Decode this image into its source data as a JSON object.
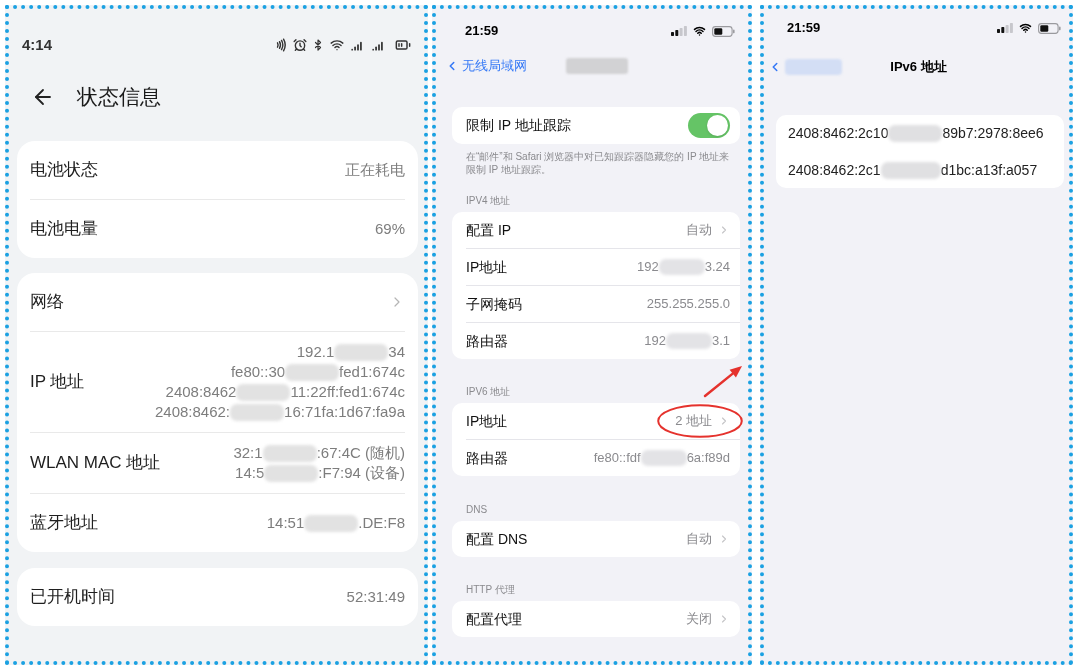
{
  "status_info_screen": {
    "status_bar": {
      "time": "4:14"
    },
    "header": {
      "title": "状态信息"
    },
    "cards": [
      {
        "rows": [
          {
            "label": "电池状态",
            "chevron": false,
            "lines": [
              [
                {
                  "kind": "text",
                  "text": "正在耗电"
                }
              ]
            ]
          },
          {
            "label": "电池电量",
            "chevron": false,
            "lines": [
              [
                {
                  "kind": "text",
                  "text": "69%"
                }
              ]
            ]
          }
        ]
      },
      {
        "rows": [
          {
            "label": "网络",
            "chevron": true,
            "lines": []
          },
          {
            "label": "IP 地址",
            "chevron": false,
            "lines": [
              [
                {
                  "kind": "text",
                  "text": "192.1"
                },
                {
                  "kind": "blurred"
                },
                {
                  "kind": "text",
                  "text": "34"
                }
              ],
              [
                {
                  "kind": "text",
                  "text": "fe80::30"
                },
                {
                  "kind": "blurred"
                },
                {
                  "kind": "text",
                  "text": "fed1:674c"
                }
              ],
              [
                {
                  "kind": "text",
                  "text": "2408:8462"
                },
                {
                  "kind": "blurred"
                },
                {
                  "kind": "text",
                  "text": "11:22ff:fed1:674c"
                }
              ],
              [
                {
                  "kind": "text",
                  "text": "2408:8462:"
                },
                {
                  "kind": "blurred"
                },
                {
                  "kind": "text",
                  "text": "16:71fa:1d67:fa9a"
                }
              ]
            ]
          },
          {
            "label": "WLAN MAC 地址",
            "chevron": false,
            "lines": [
              [
                {
                  "kind": "text",
                  "text": "32:1"
                },
                {
                  "kind": "blurred"
                },
                {
                  "kind": "text",
                  "text": ":67:4C (随机)"
                }
              ],
              [
                {
                  "kind": "text",
                  "text": "14:5"
                },
                {
                  "kind": "blurred"
                },
                {
                  "kind": "text",
                  "text": ":F7:94 (设备)"
                }
              ]
            ]
          },
          {
            "label": "蓝牙地址",
            "chevron": false,
            "lines": [
              [
                {
                  "kind": "text",
                  "text": "14:51"
                },
                {
                  "kind": "blurred"
                },
                {
                  "kind": "text",
                  "text": ".DE:F8"
                }
              ]
            ]
          }
        ]
      },
      {
        "rows": [
          {
            "label": "已开机时间",
            "chevron": false,
            "lines": [
              [
                {
                  "kind": "text",
                  "text": "52:31:49"
                }
              ]
            ]
          }
        ]
      }
    ]
  },
  "wlan_detail_screen": {
    "status_bar": {
      "time": "21:59"
    },
    "nav": {
      "back": [
        {
          "kind": "text",
          "text": "无线局域网"
        }
      ],
      "title": [
        {
          "kind": "blurred"
        }
      ]
    },
    "privacy": {
      "label": "限制 IP 地址跟踪",
      "on": true,
      "footer": "在“邮件”和 Safari 浏览器中对已知跟踪器隐藏您的 IP 地址来限制 IP 地址跟踪。"
    },
    "sections": [
      {
        "header": "IPV4 地址",
        "rows": [
          {
            "label": "配置 IP",
            "chevron": true,
            "circled": false,
            "value": [
              {
                "kind": "text",
                "text": "自动"
              }
            ]
          },
          {
            "label": "IP地址",
            "chevron": false,
            "circled": false,
            "value": [
              {
                "kind": "text",
                "text": "192"
              },
              {
                "kind": "blurred"
              },
              {
                "kind": "text",
                "text": "3.24"
              }
            ]
          },
          {
            "label": "子网掩码",
            "chevron": false,
            "circled": false,
            "value": [
              {
                "kind": "text",
                "text": "255.255.255.0"
              }
            ]
          },
          {
            "label": "路由器",
            "chevron": false,
            "circled": false,
            "value": [
              {
                "kind": "text",
                "text": "192"
              },
              {
                "kind": "blurred"
              },
              {
                "kind": "text",
                "text": "3.1"
              }
            ]
          }
        ]
      },
      {
        "header": "IPV6 地址",
        "rows": [
          {
            "label": "IP地址",
            "chevron": true,
            "circled": true,
            "value": [
              {
                "kind": "text",
                "text": "2 地址"
              }
            ]
          },
          {
            "label": "路由器",
            "chevron": false,
            "circled": false,
            "value": [
              {
                "kind": "text",
                "text": "fe80::fdf"
              },
              {
                "kind": "blurred"
              },
              {
                "kind": "text",
                "text": "6a:f89d"
              }
            ]
          }
        ]
      },
      {
        "header": "DNS",
        "rows": [
          {
            "label": "配置 DNS",
            "chevron": true,
            "circled": false,
            "value": [
              {
                "kind": "text",
                "text": "自动"
              }
            ]
          }
        ]
      },
      {
        "header": "HTTP 代理",
        "rows": [
          {
            "label": "配置代理",
            "chevron": true,
            "circled": false,
            "value": [
              {
                "kind": "text",
                "text": "关闭"
              }
            ]
          }
        ]
      }
    ],
    "annotations": [
      {
        "kind": "arrow"
      }
    ]
  },
  "ipv6_screen": {
    "status_bar": {
      "time": "21:59"
    },
    "nav": {
      "back": [
        {
          "kind": "blurred"
        }
      ],
      "title": [
        {
          "kind": "text",
          "text": "IPv6 地址"
        }
      ]
    },
    "addresses": [
      [
        {
          "kind": "text",
          "text": "2408:8462:2c10"
        },
        {
          "kind": "blurred"
        },
        {
          "kind": "text",
          "text": "89b7:2978:8ee6"
        }
      ],
      [
        {
          "kind": "text",
          "text": "2408:8462:2c1"
        },
        {
          "kind": "blurred"
        },
        {
          "kind": "text",
          "text": "d1bc:a13f:a057"
        }
      ]
    ]
  }
}
